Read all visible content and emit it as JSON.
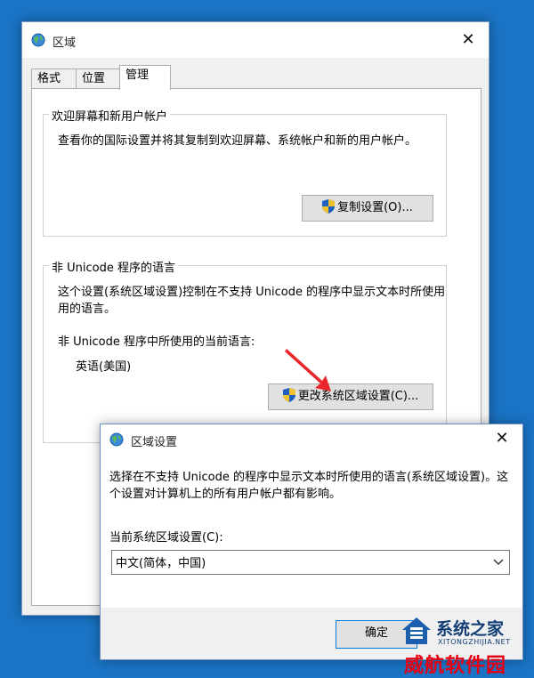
{
  "main_window": {
    "title": "区域",
    "close_glyph": "✕",
    "tabs": [
      {
        "label": "格式",
        "active": false
      },
      {
        "label": "位置",
        "active": false
      },
      {
        "label": "管理",
        "active": true
      }
    ],
    "welcome_group": {
      "label": "欢迎屏幕和新用户帐户",
      "description": "查看你的国际设置并将其复制到欢迎屏幕、系统帐户和新的用户帐户。",
      "copy_button_label": "复制设置(O)..."
    },
    "unicode_group": {
      "label": "非 Unicode 程序的语言",
      "description_line1": "这个设置(系统区域设置)控制在不支持 Unicode 的程序中显示文本时所使用",
      "description_line2": "用的语言。",
      "current_label": "非 Unicode 程序中所使用的当前语言:",
      "current_value": "英语(美国)",
      "change_button_label": "更改系统区域设置(C)..."
    }
  },
  "dialog": {
    "title": "区域设置",
    "close_glyph": "✕",
    "description_line1": "选择在不支持 Unicode 的程序中显示文本时所使用的语言(系统区域设置)。这",
    "description_line2": "个设置对计算机上的所有用户帐户都有影响。",
    "locale_label": "当前系统区域设置(C):",
    "locale_value": "中文(简体，中国)",
    "ok_button_label": "确定"
  },
  "watermark": {
    "title": "系统之家",
    "subtitle": "XITONGZHIJIA.NET",
    "red_text": "威航软件园"
  },
  "colors": {
    "desktop": "#1a73c4",
    "arrow": "#e8262b",
    "shield_blue": "#1f5fbf",
    "shield_yellow": "#f2c12e"
  },
  "icons": {
    "title_icon": "globe-icon",
    "button_icon": "uac-shield-icon",
    "dropdown_icon": "chevron-down-icon"
  }
}
